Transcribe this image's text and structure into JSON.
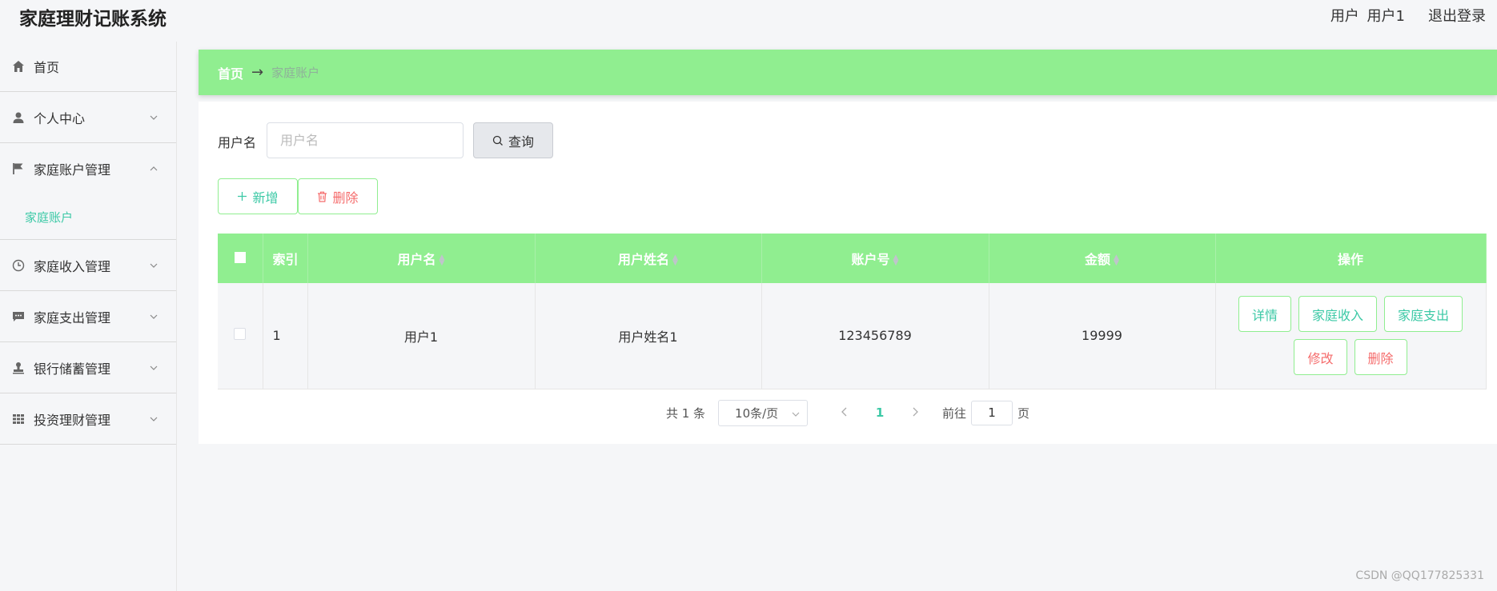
{
  "app": {
    "title": "家庭理财记账系统"
  },
  "header": {
    "user_prefix": "用户",
    "user_name": "用户1",
    "logout": "退出登录"
  },
  "sidebar": {
    "items": [
      {
        "label": "首页",
        "icon": "home-icon"
      },
      {
        "label": "个人中心",
        "icon": "user-icon"
      },
      {
        "label": "家庭账户管理",
        "icon": "flag-icon",
        "expanded": true,
        "children": [
          "家庭账户"
        ]
      },
      {
        "label": "家庭收入管理",
        "icon": "clock-icon"
      },
      {
        "label": "家庭支出管理",
        "icon": "chat-icon"
      },
      {
        "label": "银行储蓄管理",
        "icon": "stamp-icon"
      },
      {
        "label": "投资理财管理",
        "icon": "grid-icon"
      }
    ]
  },
  "breadcrumb": {
    "home": "首页",
    "arrow": "→",
    "current": "家庭账户"
  },
  "search": {
    "label": "用户名",
    "placeholder": "用户名",
    "button": "查询"
  },
  "actions": {
    "add": "新增",
    "delete": "删除"
  },
  "table": {
    "headers": [
      "索引",
      "用户名",
      "用户姓名",
      "账户号",
      "金额",
      "操作"
    ],
    "rows": [
      {
        "index": "1",
        "username": "用户1",
        "fullname": "用户姓名1",
        "account": "123456789",
        "amount": "19999"
      }
    ],
    "row_actions": [
      "详情",
      "家庭收入",
      "家庭支出",
      "修改",
      "删除"
    ]
  },
  "pagination": {
    "total": "共 1 条",
    "page_size": "10条/页",
    "current_page": "1",
    "goto_prefix": "前往",
    "goto_value": "1",
    "goto_suffix": "页"
  },
  "colors": {
    "accent": "#90ee90",
    "teal": "#3cc9a6",
    "danger": "#f56c6c"
  },
  "watermark": "CSDN @QQ177825331"
}
